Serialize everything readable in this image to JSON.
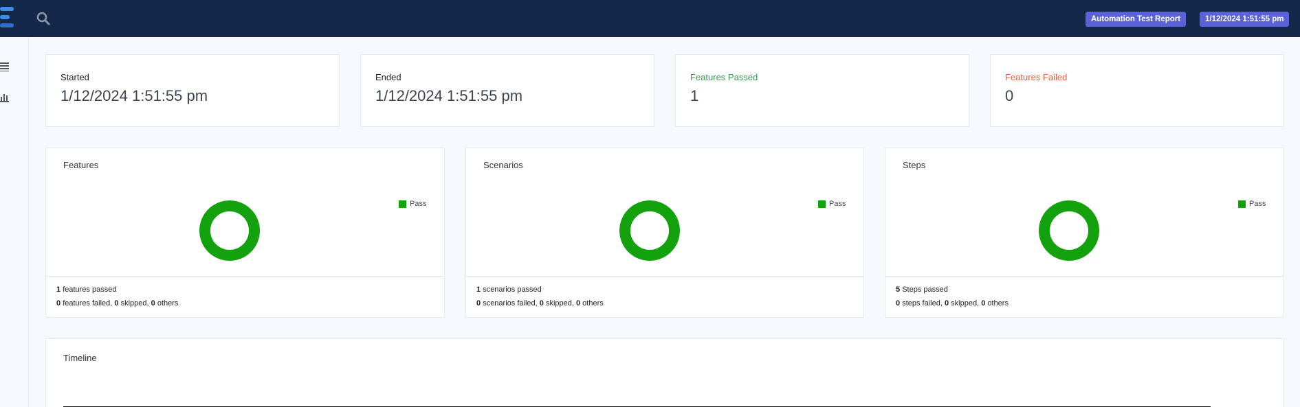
{
  "header": {
    "report_badge": "Automation Test Report",
    "date_badge": "1/12/2024 1:51:55 pm"
  },
  "stats": [
    {
      "label": "Started",
      "value": "1/12/2024 1:51:55 pm"
    },
    {
      "label": "Ended",
      "value": "1/12/2024 1:51:55 pm"
    },
    {
      "label": "Features Passed",
      "value": "1"
    },
    {
      "label": "Features Failed",
      "value": "0"
    }
  ],
  "charts": [
    {
      "title": "Features",
      "legend": "Pass",
      "passed_count": "1",
      "passed_text": "features passed",
      "failed_count": "0",
      "failed_text": "features failed,",
      "skipped_count": "0",
      "skipped_text": "skipped,",
      "others_count": "0",
      "others_text": "others"
    },
    {
      "title": "Scenarios",
      "legend": "Pass",
      "passed_count": "1",
      "passed_text": "scenarios passed",
      "failed_count": "0",
      "failed_text": "scenarios failed,",
      "skipped_count": "0",
      "skipped_text": "skipped,",
      "others_count": "0",
      "others_text": "others"
    },
    {
      "title": "Steps",
      "legend": "Pass",
      "passed_count": "5",
      "passed_text": "Steps passed",
      "failed_count": "0",
      "failed_text": "steps failed,",
      "skipped_count": "0",
      "skipped_text": "skipped,",
      "others_count": "0",
      "others_text": "others"
    }
  ],
  "timeline": {
    "title": "Timeline"
  },
  "colors": {
    "header_bg": "#14294a",
    "badge_bg": "#5b62d9",
    "pass": "#13a10e",
    "label_pass": "#3a9b4f",
    "label_fail": "#e0623b"
  },
  "icons": {
    "search": "search-icon",
    "nav_dashboard": "list-icon",
    "nav_charts": "bar-chart-icon",
    "logo": "logo-icon"
  }
}
